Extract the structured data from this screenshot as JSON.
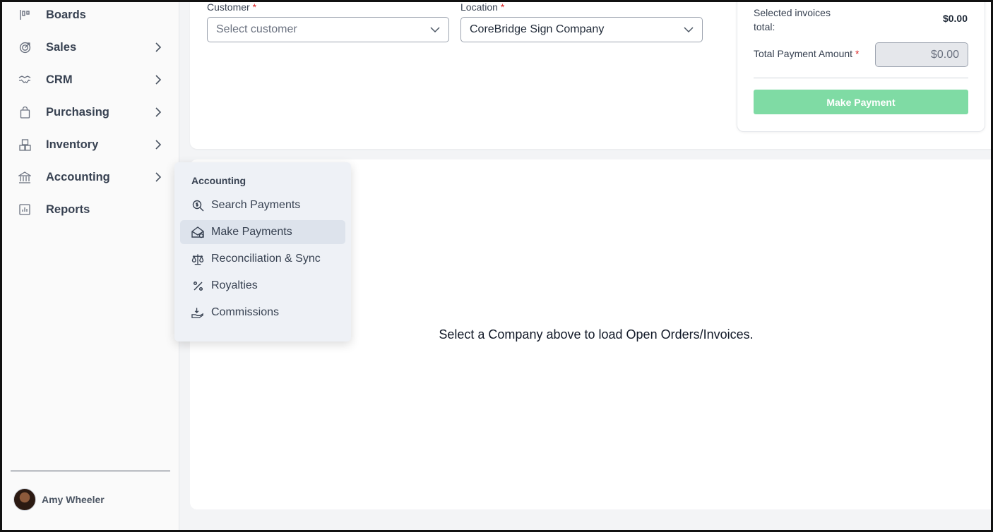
{
  "sidebar": {
    "items": [
      {
        "label": "Boards",
        "icon": "boards-icon",
        "has_submenu": false
      },
      {
        "label": "Sales",
        "icon": "target-icon",
        "has_submenu": true
      },
      {
        "label": "CRM",
        "icon": "handshake-icon",
        "has_submenu": true
      },
      {
        "label": "Purchasing",
        "icon": "shopping-bag-icon",
        "has_submenu": true
      },
      {
        "label": "Inventory",
        "icon": "boxes-icon",
        "has_submenu": true
      },
      {
        "label": "Accounting",
        "icon": "bank-icon",
        "has_submenu": true
      },
      {
        "label": "Reports",
        "icon": "chart-icon",
        "has_submenu": false
      }
    ],
    "user": {
      "name": "Amy Wheeler"
    }
  },
  "form": {
    "customer": {
      "label": "Customer",
      "required_mark": "*",
      "placeholder": "Select customer"
    },
    "location": {
      "label": "Location",
      "required_mark": "*",
      "value": "CoreBridge Sign Company"
    }
  },
  "summary": {
    "selected_label": "Selected invoices total:",
    "selected_value": "$0.00",
    "total_label": "Total Payment Amount",
    "required_mark": "*",
    "total_value": "$0.00",
    "button_label": "Make Payment",
    "button_color": "#7fdba4"
  },
  "flyout": {
    "title": "Accounting",
    "items": [
      {
        "label": "Search Payments",
        "icon": "search-dollar-icon",
        "active": false
      },
      {
        "label": "Make Payments",
        "icon": "envelope-open-dollar-icon",
        "active": true
      },
      {
        "label": "Reconciliation & Sync",
        "icon": "scale-icon",
        "active": false
      },
      {
        "label": "Royalties",
        "icon": "percent-icon",
        "active": false
      },
      {
        "label": "Commissions",
        "icon": "hand-coin-icon",
        "active": false
      }
    ]
  },
  "main": {
    "empty_message": "Select a Company above to load Open Orders/Invoices."
  }
}
